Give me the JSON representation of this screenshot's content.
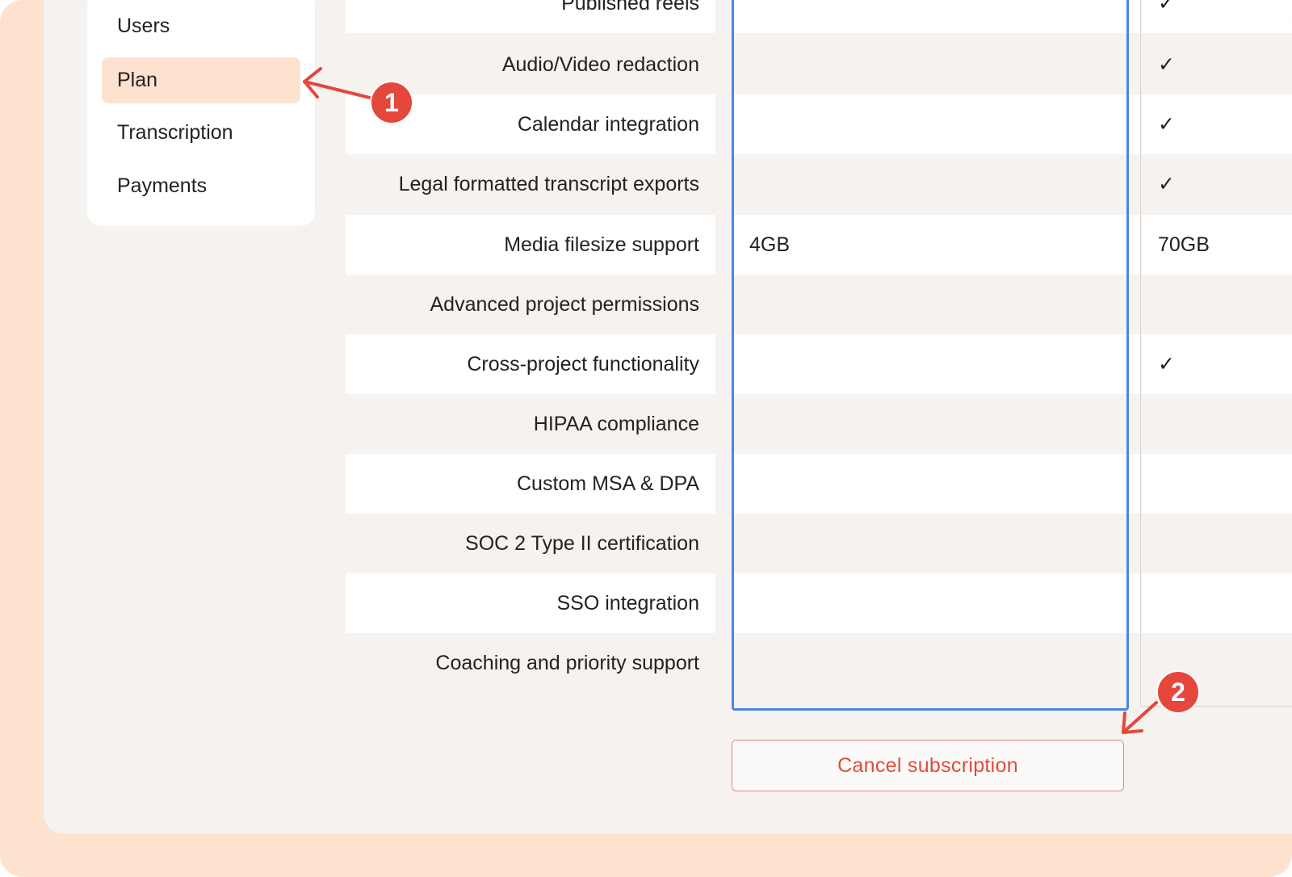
{
  "sidebar": {
    "items": [
      {
        "label": "Users"
      },
      {
        "label": "Plan"
      },
      {
        "label": "Transcription"
      },
      {
        "label": "Payments"
      }
    ],
    "active": "Plan"
  },
  "features": [
    {
      "label": "Published reels",
      "plan": "",
      "upgrade": "✓"
    },
    {
      "label": "Audio/Video redaction",
      "plan": "",
      "upgrade": "✓"
    },
    {
      "label": "Calendar integration",
      "plan": "",
      "upgrade": "✓"
    },
    {
      "label": "Legal formatted transcript exports",
      "plan": "",
      "upgrade": "✓"
    },
    {
      "label": "Media filesize support",
      "plan": "4GB",
      "upgrade": "70GB"
    },
    {
      "label": "Advanced project permissions",
      "plan": "",
      "upgrade": ""
    },
    {
      "label": "Cross-project functionality",
      "plan": "",
      "upgrade": "✓"
    },
    {
      "label": "HIPAA compliance",
      "plan": "",
      "upgrade": ""
    },
    {
      "label": "Custom MSA & DPA",
      "plan": "",
      "upgrade": ""
    },
    {
      "label": "SOC 2 Type II certification",
      "plan": "",
      "upgrade": ""
    },
    {
      "label": "SSO integration",
      "plan": "",
      "upgrade": ""
    },
    {
      "label": "Coaching and priority support",
      "plan": "",
      "upgrade": ""
    }
  ],
  "actions": {
    "cancel_label": "Cancel subscription"
  },
  "annotations": {
    "step1": "1",
    "step2": "2"
  },
  "colors": {
    "accent_peach": "#fde3cf",
    "selected_border": "#4a86e8",
    "danger": "#e24a3b",
    "annotation": "#e5473c"
  }
}
